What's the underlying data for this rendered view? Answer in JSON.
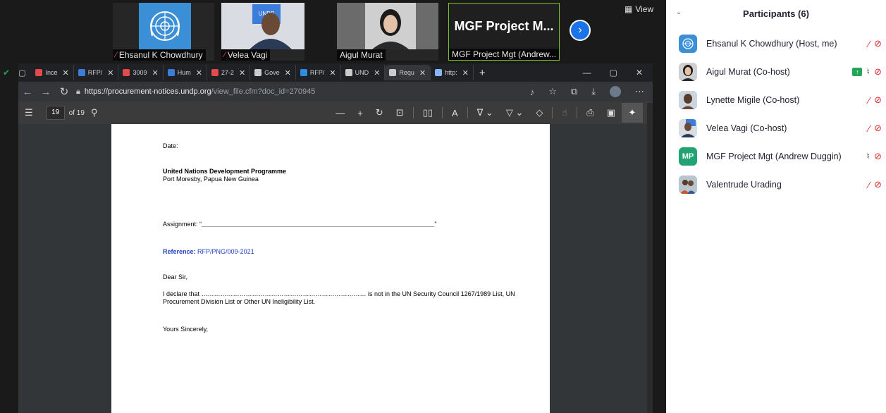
{
  "meeting": {
    "tiles": [
      {
        "name": "Ehsanul K Chowdhury",
        "muted": true
      },
      {
        "name": "Velea Vagi",
        "muted": true
      },
      {
        "name": "Aigul Murat",
        "muted": false
      },
      {
        "name": "MGF Project Mgt (Andrew...",
        "big_label": "MGF Project M...",
        "muted": false
      }
    ],
    "view_label": "View"
  },
  "browser": {
    "tabs": [
      {
        "label": "Ince",
        "icon": "pdf-icon",
        "color": "#e34a4a"
      },
      {
        "label": "RFP/",
        "icon": "un-icon",
        "color": "#3b7dd8"
      },
      {
        "label": "3009",
        "icon": "pdf-icon",
        "color": "#e34a4a"
      },
      {
        "label": "Hum",
        "icon": "globe-icon",
        "color": "#3b7dd8"
      },
      {
        "label": "27-2",
        "icon": "pdf-icon",
        "color": "#e34a4a"
      },
      {
        "label": "Gove",
        "icon": "doc-icon",
        "color": "#cccccc"
      },
      {
        "label": "RFP/",
        "icon": "bing-icon",
        "color": "#2d8ce0"
      },
      {
        "label": "UND",
        "icon": "doc-icon",
        "color": "#cccccc"
      },
      {
        "label": "Requ",
        "icon": "doc-icon",
        "color": "#cccccc",
        "active": true
      },
      {
        "label": "http:",
        "icon": "loading-icon",
        "color": "#8ab4f8"
      }
    ],
    "url_host": "https://procurement-notices.undp.org",
    "url_path": "/view_file.cfm?doc_id=270945",
    "pdf": {
      "page_current": "19",
      "page_total": "of 19"
    }
  },
  "document": {
    "date_label": "Date:",
    "org_name": "United Nations Development Programme",
    "org_location": "Port Moresby, Papua New Guinea",
    "assignment_label": "Assignment: “",
    "assignment_blank": "__________________________________________________________________",
    "assignment_end": "”",
    "reference_label": "Reference:",
    "reference_value": "RFP/PNG/009-2021",
    "salutation": "Dear Sir,",
    "declaration_line1": "I declare that …………………………………………………………………… is not in the UN Security Council 1267/1989 List, UN",
    "declaration_line2": "Procurement Division List or Other UN Ineligibility List.",
    "closing": "Yours Sincerely,"
  },
  "participants": {
    "title": "Participants (6)",
    "list": [
      {
        "name": "Ehsanul K Chowdhury (Host, me)",
        "mic": "muted",
        "video": "off",
        "avatar": "un-logo"
      },
      {
        "name": "Aigul Murat (Co-host)",
        "mic": "on",
        "video": "off",
        "sharing": true,
        "avatar": "photo"
      },
      {
        "name": "Lynette Migile (Co-host)",
        "mic": "muted",
        "video": "off",
        "avatar": "photo"
      },
      {
        "name": "Velea Vagi (Co-host)",
        "mic": "muted",
        "video": "off",
        "avatar": "photo"
      },
      {
        "name": "MGF Project Mgt (Andrew Duggin)",
        "mic": "on",
        "video": "off",
        "avatar": "MP"
      },
      {
        "name": "Valentrude Urading",
        "mic": "muted",
        "video": "off",
        "avatar": "photo"
      }
    ]
  },
  "colors": {
    "accent_blue": "#1a73e8",
    "active_speaker": "#7ec22b",
    "muted_red": "#e02828",
    "share_green": "#23a55a"
  }
}
